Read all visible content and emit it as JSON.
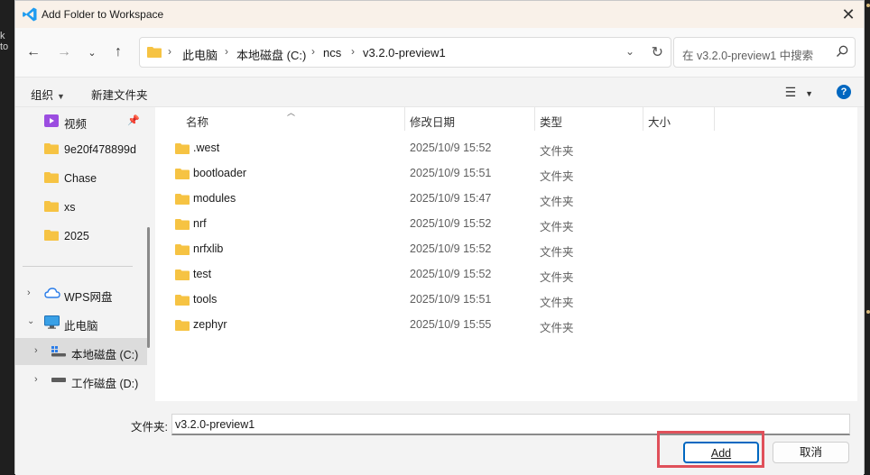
{
  "background": {
    "edge_text": "k to"
  },
  "dialog": {
    "title": "Add Folder to Workspace"
  },
  "nav": {
    "breadcrumbs": [
      "此电脑",
      "本地磁盘 (C:)",
      "ncs",
      "v3.2.0-preview1"
    ],
    "search_placeholder": "在 v3.2.0-preview1 中搜索"
  },
  "toolbar": {
    "organize": "组织",
    "new_folder": "新建文件夹",
    "help": "?"
  },
  "sidebar": {
    "quick": [
      {
        "label": "视频",
        "icon": "video-folder-icon",
        "pinned": true
      },
      {
        "label": "9e20f478899d",
        "icon": "folder-icon"
      },
      {
        "label": "Chase",
        "icon": "folder-icon"
      },
      {
        "label": "xs",
        "icon": "folder-icon"
      },
      {
        "label": "2025",
        "icon": "folder-icon"
      }
    ],
    "tree": [
      {
        "label": "WPS网盘",
        "icon": "cloud-icon"
      },
      {
        "label": "此电脑",
        "icon": "computer-icon",
        "expanded": true
      },
      {
        "label": "本地磁盘 (C:)",
        "icon": "windows-drive-icon",
        "selected": true
      },
      {
        "label": "工作磁盘 (D:)",
        "icon": "drive-icon"
      }
    ]
  },
  "files": {
    "columns": [
      "名称",
      "修改日期",
      "类型",
      "大小"
    ],
    "rows": [
      {
        "name": ".west",
        "modified": "2025/10/9 15:52",
        "type": "文件夹"
      },
      {
        "name": "bootloader",
        "modified": "2025/10/9 15:51",
        "type": "文件夹"
      },
      {
        "name": "modules",
        "modified": "2025/10/9 15:47",
        "type": "文件夹"
      },
      {
        "name": "nrf",
        "modified": "2025/10/9 15:52",
        "type": "文件夹"
      },
      {
        "name": "nrfxlib",
        "modified": "2025/10/9 15:52",
        "type": "文件夹"
      },
      {
        "name": "test",
        "modified": "2025/10/9 15:52",
        "type": "文件夹"
      },
      {
        "name": "tools",
        "modified": "2025/10/9 15:51",
        "type": "文件夹"
      },
      {
        "name": "zephyr",
        "modified": "2025/10/9 15:55",
        "type": "文件夹"
      }
    ]
  },
  "footer": {
    "folder_label": "文件夹:",
    "folder_value": "v3.2.0-preview1",
    "add_label": "Add",
    "cancel_label": "取消"
  },
  "colors": {
    "accent": "#0067c0",
    "folder": "#f6c343",
    "highlight": "#e0505a",
    "vscode_blue": "#1f9cf0"
  }
}
